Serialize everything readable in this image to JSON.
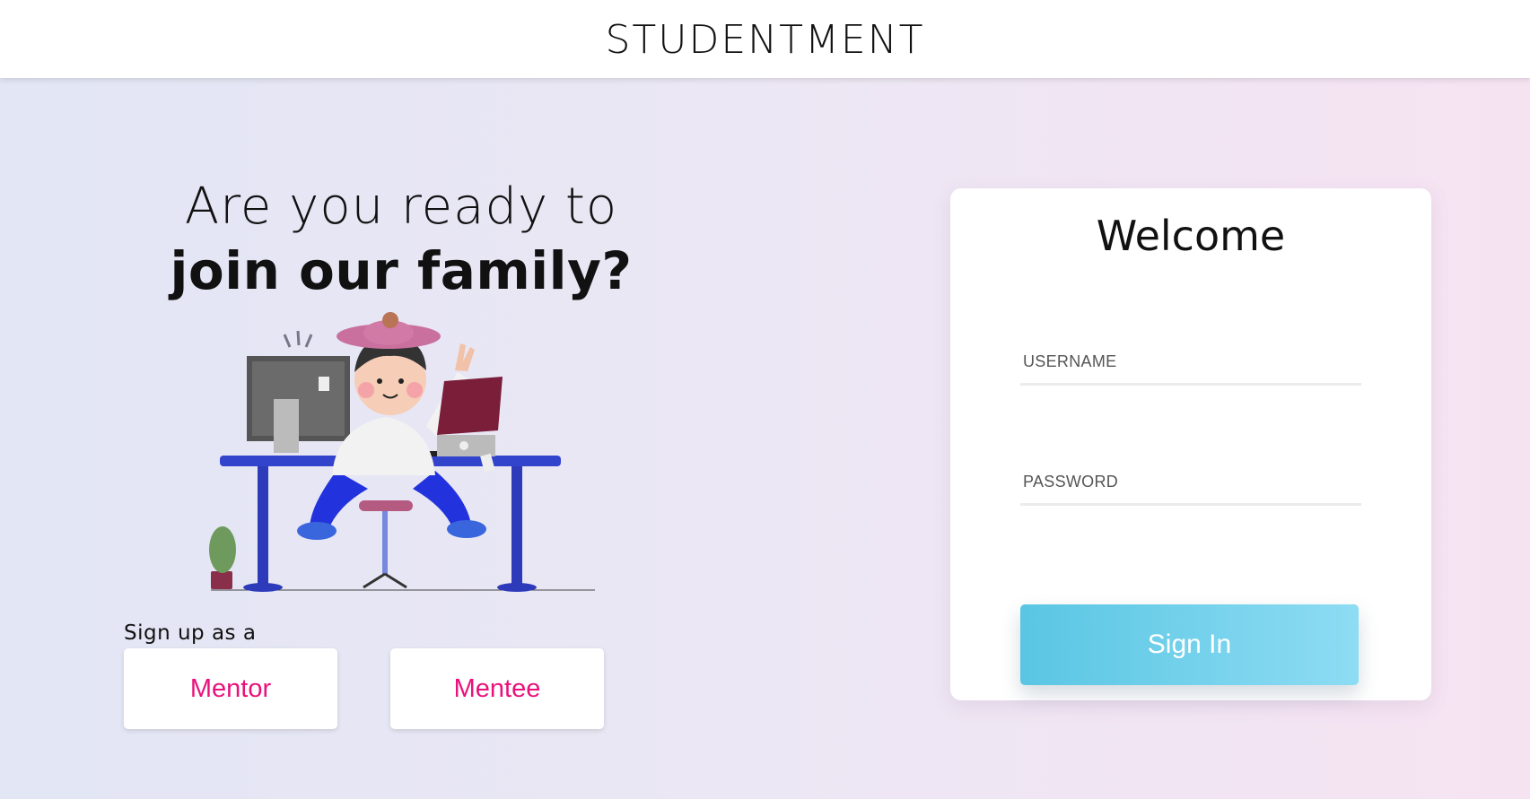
{
  "header": {
    "brand": "STUDENTMENT"
  },
  "hero": {
    "line1": "Are you ready to",
    "line2": "join our family?"
  },
  "signup": {
    "label": "Sign up as a",
    "mentor_label": "Mentor",
    "mentee_label": "Mentee"
  },
  "login": {
    "title": "Welcome",
    "username_placeholder": "USERNAME",
    "password_placeholder": "PASSWORD",
    "signin_label": "Sign In"
  },
  "colors": {
    "accent_pink": "#e8127a",
    "button_cyan": "#5ac6e3"
  }
}
